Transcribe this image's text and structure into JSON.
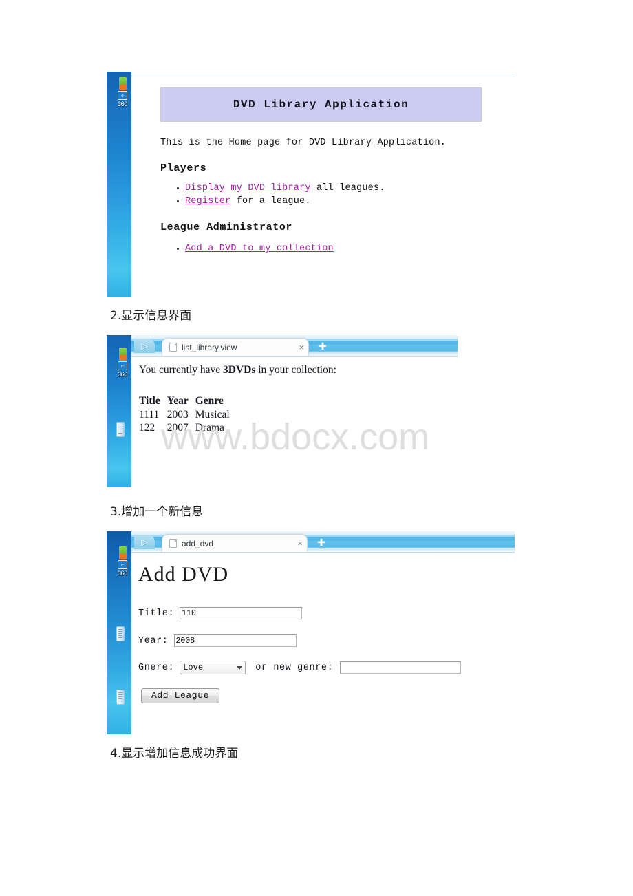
{
  "document": {
    "watermark": "www.bdocx.com"
  },
  "captions": [
    {
      "text": "2.显示信息界面"
    },
    {
      "text": "3.增加一个新信息"
    },
    {
      "text": "4.显示增加信息成功界面"
    }
  ],
  "desktop": {
    "icon_label": "360",
    "icon_green_name": "360-safe-icon",
    "icon_blue_name": "ie-browser-icon"
  },
  "screenshots": [
    {
      "id": "home-page",
      "header_title": "DVD Library Application",
      "intro": "This is the Home page for DVD Library Application.",
      "sections": [
        {
          "heading": "Players",
          "items": [
            {
              "link": "Display my DVD library",
              "rest": " all leagues."
            },
            {
              "link": "Register",
              "rest": " for a league."
            }
          ]
        },
        {
          "heading": "League Administrator",
          "items": [
            {
              "link": "Add a DVD to my collection",
              "rest": ""
            }
          ]
        }
      ],
      "link_color": "#a0219e",
      "header_bg": "#ccccf2"
    },
    {
      "id": "list-library",
      "tab": {
        "title": "list_library.view",
        "close_label": "×",
        "new_tab_label": "✚",
        "nav_label": "▷"
      },
      "sentence_prefix": "You currently have ",
      "count": "3",
      "count_unit": "DVDs",
      "sentence_suffix": " in your collection:",
      "table": {
        "headers": [
          "Title",
          "Year",
          "Genre"
        ],
        "rows": [
          [
            "1111",
            "2003",
            "Musical"
          ],
          [
            "122",
            "2007",
            "Drama"
          ]
        ]
      }
    },
    {
      "id": "add-dvd",
      "tab": {
        "title": "add_dvd",
        "close_label": "×",
        "new_tab_label": "✚",
        "nav_label": "▷"
      },
      "page_heading": "Add DVD",
      "form": {
        "title_label": "Title:",
        "title_value": "110",
        "year_label": "Year:",
        "year_value": "2008",
        "genre_label": "Gnere:",
        "genre_selected": "Love",
        "genre_or_label": "or new genre:",
        "new_genre_value": "",
        "submit_label": "Add League"
      }
    }
  ]
}
